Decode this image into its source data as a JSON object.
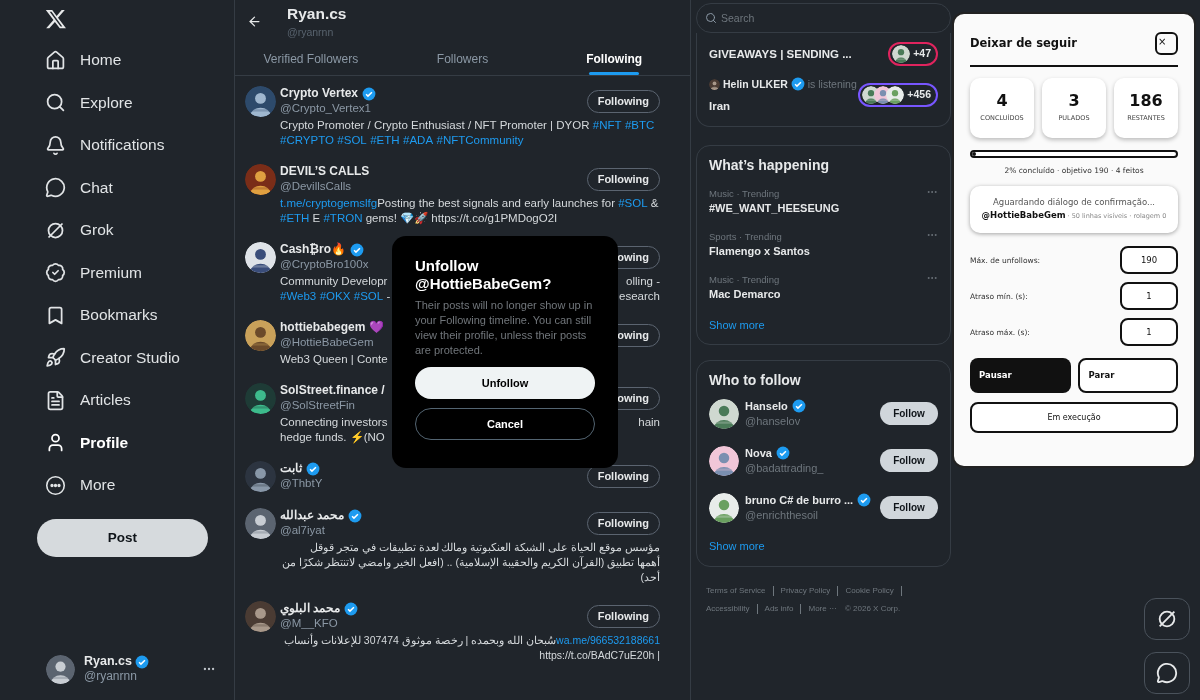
{
  "sidebar": {
    "items": [
      {
        "label": "Home",
        "selected": false
      },
      {
        "label": "Explore",
        "selected": false
      },
      {
        "label": "Notifications",
        "selected": false
      },
      {
        "label": "Chat",
        "selected": false
      },
      {
        "label": "Grok",
        "selected": false
      },
      {
        "label": "Premium",
        "selected": false
      },
      {
        "label": "Bookmarks",
        "selected": false
      },
      {
        "label": "Creator Studio",
        "selected": false
      },
      {
        "label": "Articles",
        "selected": false
      },
      {
        "label": "Profile",
        "selected": true
      },
      {
        "label": "More",
        "selected": false
      }
    ],
    "post_button": "Post",
    "account": {
      "name": "Ryan.cs",
      "verified": true,
      "handle": "@ryanrnn"
    }
  },
  "header": {
    "title": "Ryan.cs",
    "subtitle": "@ryanrnn"
  },
  "tabs": [
    {
      "label": "Verified Followers",
      "selected": false
    },
    {
      "label": "Followers",
      "selected": false
    },
    {
      "label": "Following",
      "selected": true
    }
  ],
  "following": [
    {
      "name": "Crypto Vertex",
      "verified": true,
      "handle": "@Crypto_Vertex1",
      "button": "Following",
      "rtl": false,
      "bio_lines": [
        {
          "left": [
            {
              "text": "Crypto Promoter / Crypto Enthusiast / NFT Promoter | DYOR ",
              "link": false
            },
            {
              "text": "#NFT",
              "link": true
            },
            {
              "text": "#BTC",
              "link": true
            }
          ]
        },
        {
          "left": [
            {
              "text": "#CRYPTO",
              "link": true
            },
            {
              "text": "#SOL",
              "link": true
            },
            {
              "text": "#ETH",
              "link": true
            },
            {
              "text": "#ADA",
              "link": true
            },
            {
              "text": "#NFTCommunity",
              "link": true
            }
          ]
        }
      ]
    },
    {
      "name": "DEVIL’S CALLS",
      "verified": false,
      "handle": "@DevillsCalls",
      "button": "Following",
      "rtl": false,
      "bio_lines": [
        {
          "left": [
            {
              "text": "t.me/cryptogemslfg",
              "link": true
            },
            {
              "text": "Posting the best signals and early launches for ",
              "link": false
            },
            {
              "text": "#SOL",
              "link": true
            },
            {
              "text": " &",
              "link": false
            }
          ]
        },
        {
          "left": [
            {
              "text": "#ETH",
              "link": true
            },
            {
              "text": " E ",
              "link": false
            },
            {
              "text": "#TRON",
              "link": true
            },
            {
              "text": " gems! 💎🚀 https://t.co/g1PMDogO2I",
              "link": false
            }
          ]
        }
      ]
    },
    {
      "name": "Cash₿ro🔥",
      "verified": true,
      "handle": "@CryptoBro100x",
      "button": "owing",
      "rtl": false,
      "bio_lines": [
        {
          "left": [
            {
              "text": "Community Developr",
              "link": false
            }
          ],
          "right": [
            {
              "text": "olling -",
              "link": false
            }
          ]
        },
        {
          "left": [
            {
              "text": "#Web3",
              "link": true
            },
            {
              "text": "#OKX",
              "link": true
            },
            {
              "text": "#SOL",
              "link": true
            },
            {
              "text": " -",
              "link": false
            }
          ],
          "right": [
            {
              "text": "esearch",
              "link": false
            }
          ]
        }
      ]
    },
    {
      "name": "hottiebabegem 💜",
      "verified": false,
      "handle": "@HottieBabeGem",
      "button": "owing",
      "rtl": false,
      "bio_lines": [
        {
          "left": [
            {
              "text": "Web3 Queen | Conte",
              "link": false
            }
          ]
        }
      ]
    },
    {
      "name": "SolStreet.finance /",
      "verified": false,
      "handle": "@SolStreetFin",
      "button": "owing",
      "rtl": false,
      "bio_lines": [
        {
          "left": [
            {
              "text": "Connecting investors",
              "link": false
            }
          ],
          "right": [
            {
              "text": "hain",
              "link": false
            }
          ]
        },
        {
          "left": [
            {
              "text": "hedge funds. ⚡(NO",
              "link": false
            }
          ]
        }
      ]
    },
    {
      "name": "ثابت",
      "verified": true,
      "handle": "@ThbtY",
      "button": "Following"
    },
    {
      "name": "محمد عبدالله",
      "verified": true,
      "handle": "@al7iyat",
      "button": "Following",
      "rtl": true,
      "bio_lines": [
        {
          "left": [
            {
              "text": "مؤسس موقع الحياة على الشبكة العنكبوتية ومالك لعدة تطبيقات في متجر قوقل",
              "link": false
            }
          ]
        },
        {
          "left": [
            {
              "text": "أهمها تطبيق (القرآن الكريم والحقيبة الإسلامية) .. (افعل الخير وامضي لاتنتظر شكرًا من",
              "link": false
            }
          ]
        },
        {
          "left": [
            {
              "text": "أحد)",
              "link": false
            }
          ]
        }
      ]
    },
    {
      "name": "محمد البلوي",
      "verified": true,
      "handle": "@M__KFO",
      "button": "Following",
      "rtl": true,
      "bio_lines": [
        {
          "left": [
            {
              "text": "سُبحان الله وبحمده | رخصة موثوق 307474 للإعلانات وأنساب",
              "link": false
            },
            {
              "text": "wa.me/966532188661",
              "link": true
            }
          ]
        },
        {
          "left": [
            {
              "text": "https://t.co/BAdC7uE20h |",
              "link": false
            }
          ]
        }
      ]
    }
  ],
  "dialog": {
    "title": "Unfollow @HottieBabeGem?",
    "text": "Their posts will no longer show up in your Following timeline. You can still view their profile, unless their posts are protected.",
    "confirm": "Unfollow",
    "cancel": "Cancel"
  },
  "search": {
    "placeholder": "Search"
  },
  "spaces": [
    {
      "title": "GIVEAWAYS | SENDING ...",
      "count": "+47",
      "color": "#e0245e"
    },
    {
      "listener": {
        "name": "Helin ULKER",
        "verified": true,
        "status": "is listening"
      },
      "title": "Iran",
      "count": "+456",
      "color": "#7856ff"
    }
  ],
  "trends": {
    "title": "What’s happening",
    "items": [
      {
        "context": "Music · Trending",
        "title": "#WE_WANT_HEESEUNG"
      },
      {
        "context": "Sports · Trending",
        "title": "Flamengo x Santos"
      },
      {
        "context": "Music · Trending",
        "title": "Mac Demarco"
      }
    ],
    "show_more": "Show more"
  },
  "who_to_follow": {
    "title": "Who to follow",
    "users": [
      {
        "name": "Hanselo",
        "verified": true,
        "handle": "@hanselov",
        "button": "Follow"
      },
      {
        "name": "Nova",
        "verified": true,
        "handle": "@badattrading_",
        "button": "Follow"
      },
      {
        "name": "bruno C# de burro ...",
        "verified": true,
        "handle": "@enrichthesoil",
        "button": "Follow"
      }
    ],
    "show_more": "Show more"
  },
  "footer": {
    "links": [
      "Terms of Service",
      "Privacy Policy",
      "Cookie Policy",
      "Accessibility",
      "Ads info",
      "More ···"
    ],
    "copyright": "© 2026 X Corp."
  },
  "extension": {
    "title": "Deixar de seguir",
    "close": "×",
    "stats": [
      {
        "value": "4",
        "label": "CONCLUÍDOS"
      },
      {
        "value": "3",
        "label": "PULADOS"
      },
      {
        "value": "186",
        "label": "RESTANTES"
      }
    ],
    "progress": {
      "level": 0.02,
      "caption": "2% concluído · objetivo 190 · 4 feitos"
    },
    "status": {
      "title": "Aguardando diálogo de confirmação...",
      "detail": "**@HottieBabeGem** · 50 linhas visíveis · rolagem 0"
    },
    "fields": [
      {
        "label": "Máx. de unfollows:",
        "value": "190"
      },
      {
        "label": "Atraso mín. (s):",
        "value": "1"
      },
      {
        "label": "Atraso máx. (s):",
        "value": "1"
      }
    ],
    "pause": "Pausar",
    "stop": "Parar",
    "state": "Em execução"
  }
}
